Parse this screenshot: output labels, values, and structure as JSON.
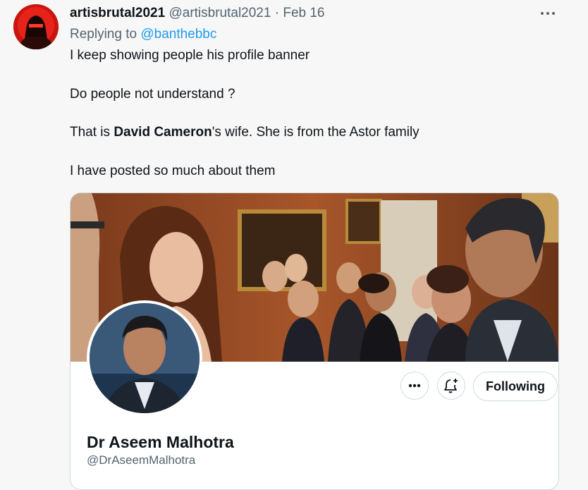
{
  "tweet": {
    "display_name": "artisbrutal2021",
    "handle": "@artisbrutal2021",
    "separator": "·",
    "date": "Feb 16",
    "replying_prefix": "Replying to ",
    "replying_to": "@banthebbc",
    "line1": "I keep showing people his profile banner",
    "line2": "Do people not understand ?",
    "line3_pre": "That is ",
    "line3_bold": "David Cameron",
    "line3_post": "'s wife. She is from the Astor family",
    "line4": "I have posted so much about them"
  },
  "card": {
    "profile_name": "Dr Aseem Malhotra",
    "profile_handle": "@DrAseemMalhotra",
    "following_label": "Following"
  },
  "icons": {
    "more": "more-horizontal-icon",
    "dots": "more-icon",
    "bell": "notification-bell-plus-icon"
  },
  "colors": {
    "link": "#1d9bf0",
    "muted": "#536471",
    "text": "#0f1419",
    "border": "#cfd9de"
  }
}
